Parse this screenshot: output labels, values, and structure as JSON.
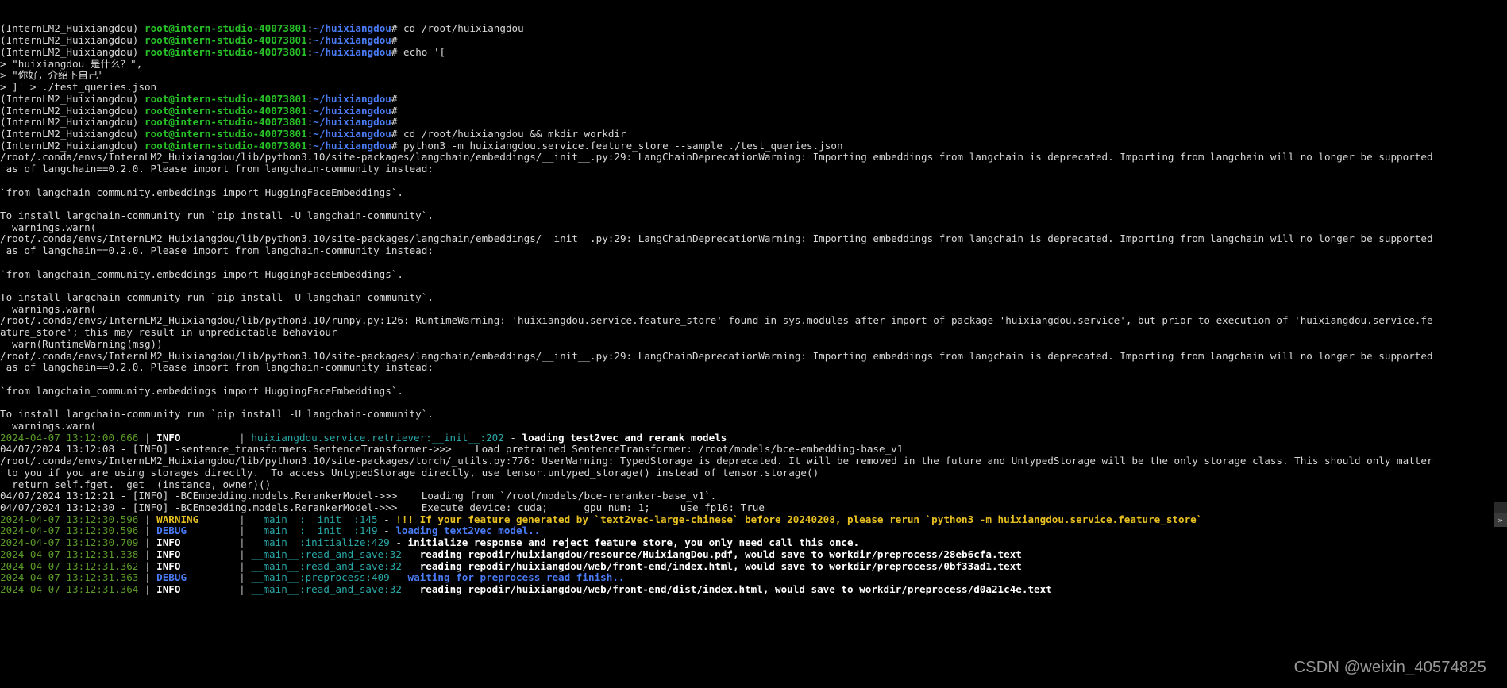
{
  "terminal": {
    "prompt": {
      "env": "(InternLM2_Huixiangdou)",
      "user_host": "root@intern-studio-40073801",
      "colon": ":",
      "path": "~/huixiangdou",
      "hash": "#"
    },
    "watermark": "CSDN @weixin_40574825",
    "scroll_arrow": "»",
    "lines": [
      {
        "type": "prompt",
        "cmd": " cd /root/huixiangdou"
      },
      {
        "type": "prompt",
        "cmd": ""
      },
      {
        "type": "prompt",
        "cmd": " echo '["
      },
      {
        "type": "plain",
        "text": "> \"huixiangdou 是什么？\","
      },
      {
        "type": "plain",
        "text": "> \"你好，介绍下自己\""
      },
      {
        "type": "plain",
        "text": "> ]' > ./test_queries.json"
      },
      {
        "type": "prompt",
        "cmd": ""
      },
      {
        "type": "prompt",
        "cmd": ""
      },
      {
        "type": "prompt",
        "cmd": ""
      },
      {
        "type": "prompt",
        "cmd": " cd /root/huixiangdou && mkdir workdir"
      },
      {
        "type": "prompt",
        "cmd": " python3 -m huixiangdou.service.feature_store --sample ./test_queries.json"
      },
      {
        "type": "plain",
        "text": "/root/.conda/envs/InternLM2_Huixiangdou/lib/python3.10/site-packages/langchain/embeddings/__init__.py:29: LangChainDeprecationWarning: Importing embeddings from langchain is deprecated. Importing from langchain will no longer be supported"
      },
      {
        "type": "plain",
        "text": " as of langchain==0.2.0. Please import from langchain-community instead:"
      },
      {
        "type": "plain",
        "text": ""
      },
      {
        "type": "plain",
        "text": "`from langchain_community.embeddings import HuggingFaceEmbeddings`."
      },
      {
        "type": "plain",
        "text": ""
      },
      {
        "type": "plain",
        "text": "To install langchain-community run `pip install -U langchain-community`."
      },
      {
        "type": "plain",
        "text": "  warnings.warn("
      },
      {
        "type": "plain",
        "text": "/root/.conda/envs/InternLM2_Huixiangdou/lib/python3.10/site-packages/langchain/embeddings/__init__.py:29: LangChainDeprecationWarning: Importing embeddings from langchain is deprecated. Importing from langchain will no longer be supported"
      },
      {
        "type": "plain",
        "text": " as of langchain==0.2.0. Please import from langchain-community instead:"
      },
      {
        "type": "plain",
        "text": ""
      },
      {
        "type": "plain",
        "text": "`from langchain_community.embeddings import HuggingFaceEmbeddings`."
      },
      {
        "type": "plain",
        "text": ""
      },
      {
        "type": "plain",
        "text": "To install langchain-community run `pip install -U langchain-community`."
      },
      {
        "type": "plain",
        "text": "  warnings.warn("
      },
      {
        "type": "plain",
        "text": "/root/.conda/envs/InternLM2_Huixiangdou/lib/python3.10/runpy.py:126: RuntimeWarning: 'huixiangdou.service.feature_store' found in sys.modules after import of package 'huixiangdou.service', but prior to execution of 'huixiangdou.service.fe"
      },
      {
        "type": "plain",
        "text": "ature_store'; this may result in unpredictable behaviour"
      },
      {
        "type": "plain",
        "text": "  warn(RuntimeWarning(msg))"
      },
      {
        "type": "plain",
        "text": "/root/.conda/envs/InternLM2_Huixiangdou/lib/python3.10/site-packages/langchain/embeddings/__init__.py:29: LangChainDeprecationWarning: Importing embeddings from langchain is deprecated. Importing from langchain will no longer be supported"
      },
      {
        "type": "plain",
        "text": " as of langchain==0.2.0. Please import from langchain-community instead:"
      },
      {
        "type": "plain",
        "text": ""
      },
      {
        "type": "plain",
        "text": "`from langchain_community.embeddings import HuggingFaceEmbeddings`."
      },
      {
        "type": "plain",
        "text": ""
      },
      {
        "type": "plain",
        "text": "To install langchain-community run `pip install -U langchain-community`."
      },
      {
        "type": "plain",
        "text": "  warnings.warn("
      },
      {
        "type": "log",
        "timestamp": "2024-04-07 13:12:00.666",
        "level": "INFO",
        "level_class": "c-infow",
        "source": "huixiangdou.service.retriever",
        "func": "__init__",
        "lineno": "202",
        "message": "loading test2vec and rerank models",
        "msg_class": "c-msgw"
      },
      {
        "type": "plain",
        "text": "04/07/2024 13:12:08 - [INFO] -sentence_transformers.SentenceTransformer->>>    Load pretrained SentenceTransformer: /root/models/bce-embedding-base_v1"
      },
      {
        "type": "plain",
        "text": "/root/.conda/envs/InternLM2_Huixiangdou/lib/python3.10/site-packages/torch/_utils.py:776: UserWarning: TypedStorage is deprecated. It will be removed in the future and UntypedStorage will be the only storage class. This should only matter"
      },
      {
        "type": "plain",
        "text": " to you if you are using storages directly.  To access UntypedStorage directly, use tensor.untyped_storage() instead of tensor.storage()"
      },
      {
        "type": "plain",
        "text": "  return self.fget.__get__(instance, owner)()"
      },
      {
        "type": "plain",
        "text": "04/07/2024 13:12:21 - [INFO] -BCEmbedding.models.RerankerModel->>>    Loading from `/root/models/bce-reranker-base_v1`."
      },
      {
        "type": "plain",
        "text": "04/07/2024 13:12:30 - [INFO] -BCEmbedding.models.RerankerModel->>>    Execute device: cuda;\t gpu num: 1;\t use fp16: True"
      },
      {
        "type": "log",
        "timestamp": "2024-04-07 13:12:30.596",
        "level": "WARNING",
        "level_class": "c-yellow",
        "source": "__main__",
        "func": "__init__",
        "lineno": "145",
        "message": "!!! If your feature generated by `text2vec-large-chinese` before 20240208, please rerun `python3 -m huixiangdou.service.feature_store`",
        "msg_class": "c-yellow"
      },
      {
        "type": "log",
        "timestamp": "2024-04-07 13:12:30.596",
        "level": "DEBUG",
        "level_class": "c-blue",
        "source": "__main__",
        "func": "__init__",
        "lineno": "149",
        "message": "loading text2vec model..",
        "msg_class": "c-blue"
      },
      {
        "type": "log",
        "timestamp": "2024-04-07 13:12:30.709",
        "level": "INFO",
        "level_class": "c-infow",
        "source": "__main__",
        "func": "initialize",
        "lineno": "429",
        "message": "initialize response and reject feature store, you only need call this once.",
        "msg_class": "c-msgw"
      },
      {
        "type": "log",
        "timestamp": "2024-04-07 13:12:31.338",
        "level": "INFO",
        "level_class": "c-infow",
        "source": "__main__",
        "func": "read_and_save",
        "lineno": "32",
        "message": "reading repodir/huixiangdou/resource/HuixiangDou.pdf, would save to workdir/preprocess/28eb6cfa.text",
        "msg_class": "c-msgw"
      },
      {
        "type": "log",
        "timestamp": "2024-04-07 13:12:31.362",
        "level": "INFO",
        "level_class": "c-infow",
        "source": "__main__",
        "func": "read_and_save",
        "lineno": "32",
        "message": "reading repodir/huixiangdou/web/front-end/index.html, would save to workdir/preprocess/0bf33ad1.text",
        "msg_class": "c-msgw"
      },
      {
        "type": "log",
        "timestamp": "2024-04-07 13:12:31.363",
        "level": "DEBUG",
        "level_class": "c-blue",
        "source": "__main__",
        "func": "preprocess",
        "lineno": "409",
        "message": "waiting for preprocess read finish..",
        "msg_class": "c-blue"
      },
      {
        "type": "log",
        "timestamp": "2024-04-07 13:12:31.364",
        "level": "INFO",
        "level_class": "c-infow",
        "source": "__main__",
        "func": "read_and_save",
        "lineno": "32",
        "message": "reading repodir/huixiangdou/web/front-end/dist/index.html, would save to workdir/preprocess/d0a21c4e.text",
        "msg_class": "c-msgw"
      }
    ]
  }
}
